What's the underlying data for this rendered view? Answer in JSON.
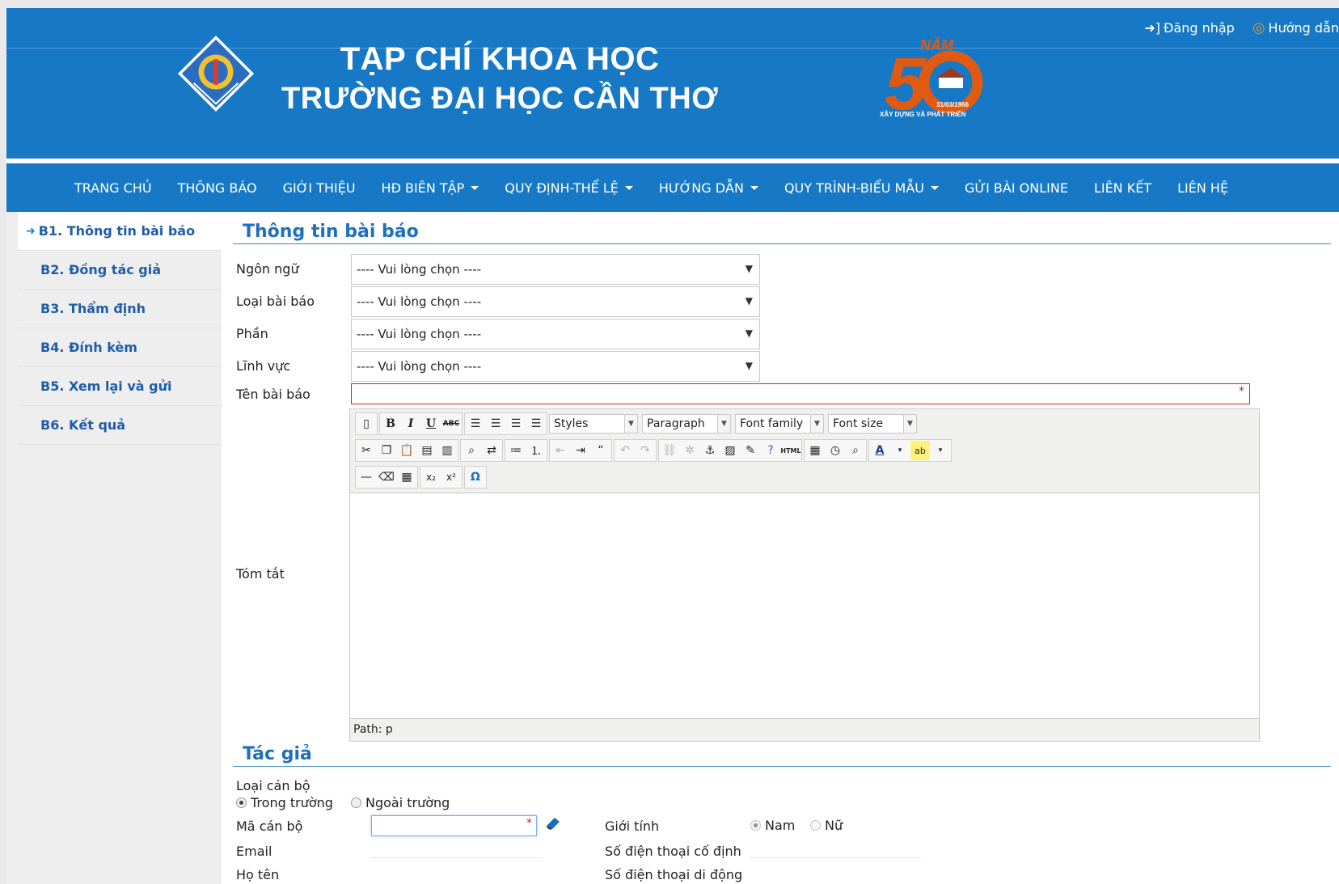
{
  "header": {
    "title_line1": "TẠP CHÍ KHOA HỌC",
    "title_line2": "TRƯỜNG ĐẠI HỌC CẦN THƠ",
    "login_label": "Đăng nhập",
    "guide_label": "Hướng dẫn",
    "logo_text": "ĐẠI HỌC CẦN THƠ",
    "anniv_nam": "NĂM",
    "anniv_date": "31/03/1966",
    "anniv_caption": "XÂY DỰNG VÀ PHÁT TRIỂN",
    "colors": {
      "brand": "#1779c6",
      "accent": "#e05a12"
    }
  },
  "nav": {
    "items": [
      {
        "label": "TRANG CHỦ"
      },
      {
        "label": "THÔNG BÁO"
      },
      {
        "label": "GIỚI THIỆU"
      },
      {
        "label": "HĐ BIÊN TẬP",
        "dropdown": true
      },
      {
        "label": "QUY ĐỊNH-THỂ LỆ",
        "dropdown": true
      },
      {
        "label": "HƯỚNG DẪN",
        "dropdown": true
      },
      {
        "label": "QUY TRÌNH-BIỂU MẪU",
        "dropdown": true
      },
      {
        "label": "GỬI BÀI ONLINE"
      },
      {
        "label": "LIÊN KẾT"
      },
      {
        "label": "LIÊN HỆ"
      }
    ]
  },
  "sidebar": {
    "items": [
      {
        "label": "B1. Thông tin bài báo",
        "active": true
      },
      {
        "label": "B2. Đồng tác giả"
      },
      {
        "label": "B3. Thẩm định"
      },
      {
        "label": "B4. Đính kèm"
      },
      {
        "label": "B5. Xem lại và gửi"
      },
      {
        "label": "B6. Kết quả"
      }
    ]
  },
  "article": {
    "section_title": "Thông tin bài báo",
    "language_label": "Ngôn ngữ",
    "type_label": "Loại bài báo",
    "part_label": "Phần",
    "field_label": "Lĩnh vực",
    "title_label": "Tên bài báo",
    "abstract_label": "Tóm tắt",
    "select_placeholder": "---- Vui lòng chọn ----",
    "required_mark": "*"
  },
  "editor": {
    "styles_label": "Styles",
    "paragraph_label": "Paragraph",
    "font_family_label": "Font family",
    "font_size_label": "Font size",
    "path_label": "Path: p"
  },
  "author": {
    "section_title": "Tác giả",
    "staff_type_label": "Loại cán bộ",
    "option_internal": "Trong trường",
    "option_external": "Ngoài trường",
    "staff_code_label": "Mã cán bộ",
    "email_label": "Email",
    "fullname_label": "Họ tên",
    "gender_label": "Giới tính",
    "gender_male": "Nam",
    "gender_female": "Nữ",
    "landline_label": "Số điện thoại cố định",
    "mobile_label": "Số điện thoại di động"
  }
}
